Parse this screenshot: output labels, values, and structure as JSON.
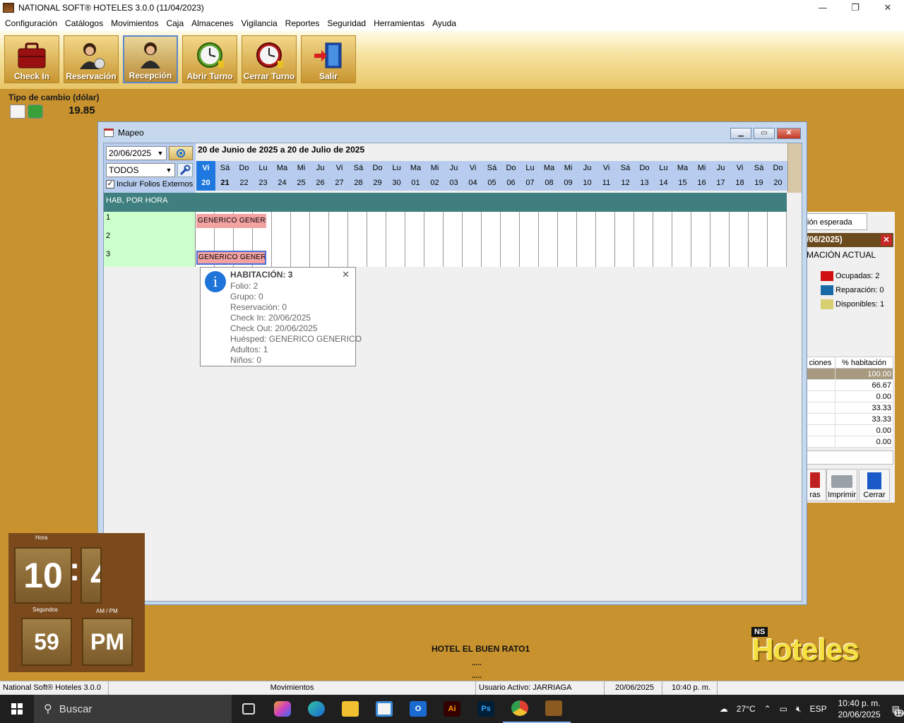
{
  "window": {
    "title": "NATIONAL SOFT® HOTELES 3.0.0 (11/04/2023)",
    "minimize": "—",
    "restore": "❐",
    "close": "✕"
  },
  "menu": [
    "Configuración",
    "Catálogos",
    "Movimientos",
    "Caja",
    "Almacenes",
    "Vigilancia",
    "Reportes",
    "Seguridad",
    "Herramientas",
    "Ayuda"
  ],
  "toolbar": {
    "buttons": [
      {
        "label": "Check In",
        "icon": "suitcase-icon"
      },
      {
        "label": "Reservación",
        "icon": "receptionist-clock-icon"
      },
      {
        "label": "Recepción",
        "icon": "receptionist-icon",
        "active": true
      },
      {
        "label": "Abrir Turno",
        "icon": "green-clock-icon"
      },
      {
        "label": "Cerrar Turno",
        "icon": "red-clock-icon"
      },
      {
        "label": "Salir",
        "icon": "exit-door-icon"
      }
    ]
  },
  "exchange": {
    "label": "Tipo de cambio (dólar)",
    "value": "19.85"
  },
  "mapeo": {
    "title": "Mapeo",
    "date": "20/06/2025",
    "filter": "TODOS",
    "include_external": "Incluir Folios Externos",
    "include_external_checked": true,
    "range_title": "20 de Junio de 2025 a 20 de Julio de 2025",
    "days": [
      {
        "n": "Vi",
        "d": "20"
      },
      {
        "n": "Sá",
        "d": "21"
      },
      {
        "n": "Do",
        "d": "22"
      },
      {
        "n": "Lu",
        "d": "23"
      },
      {
        "n": "Ma",
        "d": "24"
      },
      {
        "n": "Mi",
        "d": "25"
      },
      {
        "n": "Ju",
        "d": "26"
      },
      {
        "n": "Vi",
        "d": "27"
      },
      {
        "n": "Sá",
        "d": "28"
      },
      {
        "n": "Do",
        "d": "29"
      },
      {
        "n": "Lu",
        "d": "30"
      },
      {
        "n": "Ma",
        "d": "01"
      },
      {
        "n": "Mi",
        "d": "02"
      },
      {
        "n": "Ju",
        "d": "03"
      },
      {
        "n": "Vi",
        "d": "04"
      },
      {
        "n": "Sá",
        "d": "05"
      },
      {
        "n": "Do",
        "d": "06"
      },
      {
        "n": "Lu",
        "d": "07"
      },
      {
        "n": "Ma",
        "d": "08"
      },
      {
        "n": "Mi",
        "d": "09"
      },
      {
        "n": "Ju",
        "d": "10"
      },
      {
        "n": "Vi",
        "d": "11"
      },
      {
        "n": "Sá",
        "d": "12"
      },
      {
        "n": "Do",
        "d": "13"
      },
      {
        "n": "Lu",
        "d": "14"
      },
      {
        "n": "Ma",
        "d": "15"
      },
      {
        "n": "Mi",
        "d": "16"
      },
      {
        "n": "Ju",
        "d": "17"
      },
      {
        "n": "Vi",
        "d": "18"
      },
      {
        "n": "Sá",
        "d": "19"
      },
      {
        "n": "Do",
        "d": "20"
      }
    ],
    "group_header": "HAB, POR HORA",
    "rooms": [
      {
        "num": "1",
        "booking": "GENERICO  GENERICO",
        "selected": false
      },
      {
        "num": "2",
        "booking": "",
        "selected": false
      },
      {
        "num": "3",
        "booking": "GENERICO  GENERICO",
        "selected": true
      }
    ]
  },
  "tooltip": {
    "title": "HABITACIÓN: 3",
    "lines": [
      "Folio: 2",
      "Grupo: 0",
      "Reservación: 0",
      "Check In: 20/06/2025",
      "Check Out: 20/06/2025",
      "Huésped: GENERICO  GENERICO",
      "Adultos: 1",
      "Niños: 0"
    ]
  },
  "side_panel": {
    "tab": "ión esperada",
    "header": "/06/2025)",
    "subheader": "MACIÓN ACTUAL",
    "legend": [
      {
        "label": "Ocupadas: 2",
        "color": "#d01010"
      },
      {
        "label": "Reparación: 0",
        "color": "#1a6aa8"
      },
      {
        "label": "Disponibles: 1",
        "color": "#d8d070"
      }
    ],
    "col1": "ciones",
    "col2": "% habitación",
    "rows": [
      "100.00",
      "66.67",
      "0.00",
      "33.33",
      "33.33",
      "0.00",
      "0.00"
    ],
    "buttons": [
      "ras",
      "Imprimir",
      "Cerrar"
    ]
  },
  "clock": {
    "hour_label": "Hora",
    "hour": "10",
    "colon": ":",
    "minute_partial": "4",
    "seconds_label": "Segundos",
    "seconds": "59",
    "ampm_label": "AM / PM",
    "ampm": "PM"
  },
  "hotel": {
    "name": "HOTEL EL BUEN RATO1",
    "dots1": ".....",
    "dots2": "....."
  },
  "logo": {
    "ns": "NS",
    "text": "Hoteles"
  },
  "status": [
    "National Soft® Hoteles 3.0.0",
    "Movimientos",
    "Usuario Activo: JARRIAGA",
    "20/06/2025",
    "10:40 p. m."
  ],
  "taskbar": {
    "search": "Buscar",
    "weather": "27°C",
    "lang": "ESP",
    "time": "10:40 p. m.",
    "date": "20/06/2025",
    "notif": "12"
  }
}
